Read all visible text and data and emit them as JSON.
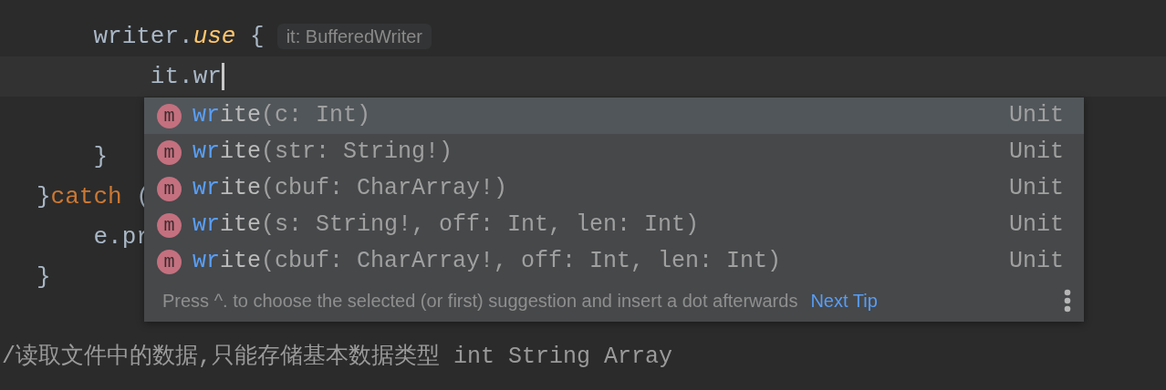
{
  "editor": {
    "lines": [
      {
        "kind": "code",
        "tokens": [
          {
            "text": "    writer.",
            "kind": "plain"
          },
          {
            "text": "use",
            "kind": "ext"
          },
          {
            "text": " {",
            "kind": "plain"
          },
          {
            "text": "it: BufferedWriter",
            "kind": "hint"
          }
        ]
      },
      {
        "kind": "current",
        "caret": true,
        "tokens": [
          {
            "text": "        it.wr",
            "kind": "plain"
          }
        ]
      },
      {
        "kind": "code"
      },
      {
        "kind": "code",
        "tokens": [
          {
            "text": "    }",
            "kind": "plain"
          }
        ]
      },
      {
        "kind": "code",
        "tokens": [
          {
            "text": "}",
            "kind": "plain"
          },
          {
            "text": "catch",
            "kind": "keyword"
          },
          {
            "text": " (",
            "kind": "plain"
          }
        ]
      },
      {
        "kind": "code",
        "tokens": [
          {
            "text": "    e.pr",
            "kind": "plain"
          }
        ]
      },
      {
        "kind": "code",
        "tokens": [
          {
            "text": "}",
            "kind": "plain"
          }
        ]
      },
      {
        "kind": "code"
      },
      {
        "kind": "code",
        "tokens": [
          {
            "text": "/读取文件中的数据,只能存储基本数据类型 int String Array",
            "kind": "comment"
          }
        ]
      }
    ]
  },
  "completion": {
    "items": [
      {
        "icon": "m",
        "match": "wr",
        "rest": "ite",
        "params": "(c: Int)",
        "type": "Unit",
        "selected": true
      },
      {
        "icon": "m",
        "match": "wr",
        "rest": "ite",
        "params": "(str: String!)",
        "type": "Unit",
        "selected": false
      },
      {
        "icon": "m",
        "match": "wr",
        "rest": "ite",
        "params": "(cbuf: CharArray!)",
        "type": "Unit",
        "selected": false
      },
      {
        "icon": "m",
        "match": "wr",
        "rest": "ite",
        "params": "(s: String!, off: Int, len: Int)",
        "type": "Unit",
        "selected": false
      },
      {
        "icon": "m",
        "match": "wr",
        "rest": "ite",
        "params": "(cbuf: CharArray!, off: Int, len: Int)",
        "type": "Unit",
        "selected": false
      }
    ],
    "tip": "Press ^. to choose the selected (or first) suggestion and insert a dot afterwards",
    "next_tip": "Next Tip"
  }
}
